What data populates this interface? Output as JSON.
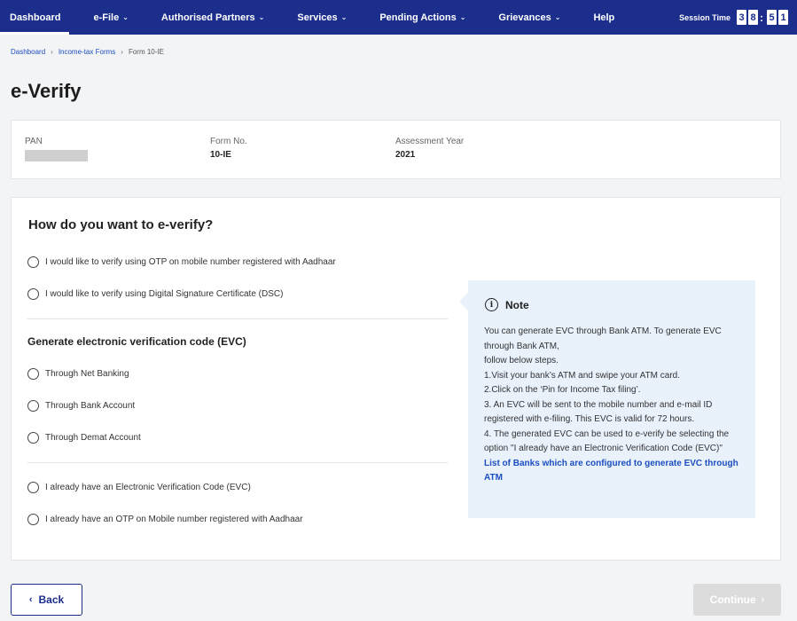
{
  "nav": {
    "items": [
      {
        "label": "Dashboard",
        "caret": false
      },
      {
        "label": "e-File",
        "caret": true
      },
      {
        "label": "Authorised Partners",
        "caret": true
      },
      {
        "label": "Services",
        "caret": true
      },
      {
        "label": "Pending Actions",
        "caret": true
      },
      {
        "label": "Grievances",
        "caret": true
      },
      {
        "label": "Help",
        "caret": false
      }
    ],
    "session_label": "Session Time",
    "session_digits": [
      "3",
      "8",
      ":",
      "5",
      "1"
    ]
  },
  "breadcrumb": {
    "items": [
      "Dashboard",
      "Income-tax Forms"
    ],
    "current": "Form 10-IE"
  },
  "page_title": "e-Verify",
  "info": {
    "pan_label": "PAN",
    "form_label": "Form No.",
    "form_value": "10-IE",
    "ay_label": "Assessment Year",
    "ay_value": "2021"
  },
  "question": "How do you want to e-verify?",
  "options_top": [
    "I would like to verify using OTP on mobile number registered with Aadhaar",
    "I would like to verify using Digital Signature Certificate (DSC)"
  ],
  "evc_title": "Generate electronic verification code (EVC)",
  "options_evc": [
    "Through Net Banking",
    "Through Bank Account",
    "Through Demat Account"
  ],
  "options_bottom": [
    "I already have an Electronic Verification Code (EVC)",
    "I already have an OTP on Mobile number registered with Aadhaar"
  ],
  "note": {
    "title": "Note",
    "line1": "You can generate EVC through Bank ATM. To generate EVC through Bank ATM,",
    "line2": "follow below steps.",
    "step1": "1.Visit your bank’s ATM and swipe your ATM card.",
    "step2": "2.Click on the ‘Pin for Income Tax filing’.",
    "step3": "3. An EVC will be sent to the mobile number and e-mail ID registered with e-filing. This EVC is valid for 72 hours.",
    "step4": "4. The generated EVC can be used to e-verify be selecting the option \"I already have an Electronic Verification Code (EVC)\"",
    "link": "List of Banks which are configured to generate EVC through ATM"
  },
  "buttons": {
    "back": "Back",
    "continue": "Continue"
  },
  "colors": {
    "nav_bg": "#1c2e8c",
    "link": "#1c4ec0",
    "note_bg": "#e9f1fb"
  }
}
